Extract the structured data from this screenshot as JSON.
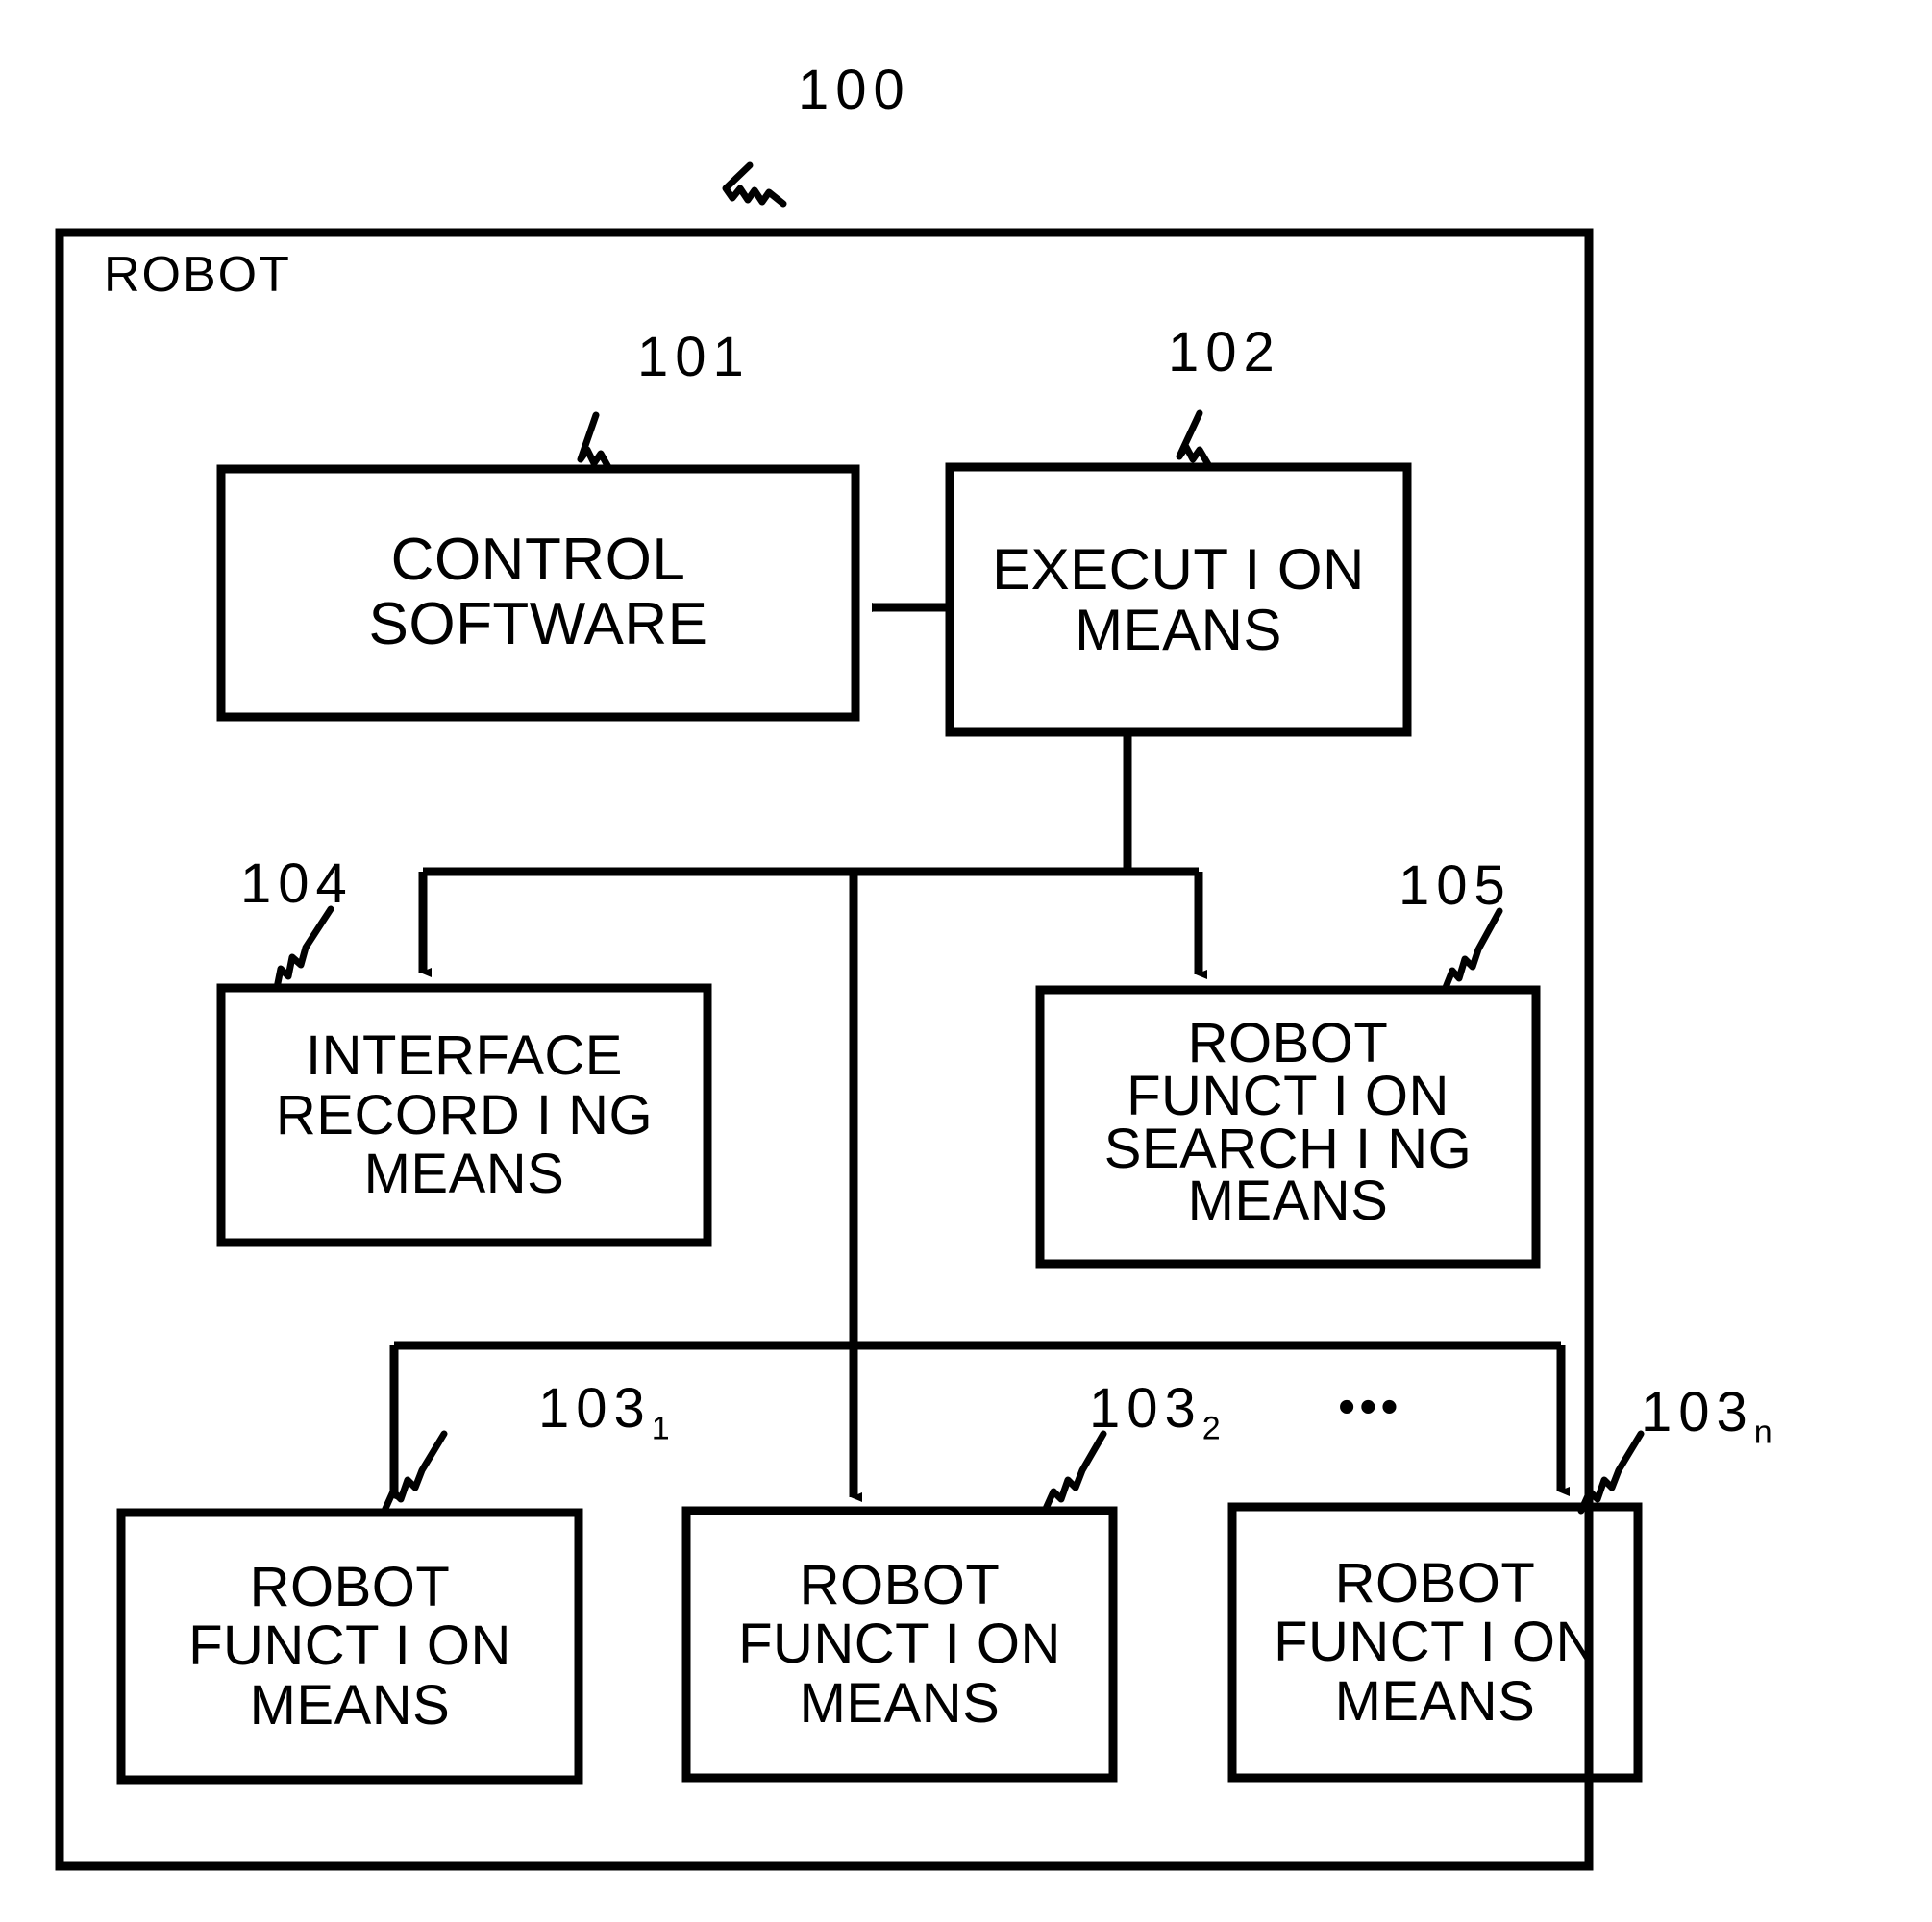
{
  "figure": {
    "top_reference": "100",
    "outer_box_title": "ROBOT"
  },
  "boxes": [
    {
      "id": "control-software",
      "reference": "101",
      "lines": [
        "CONTROL",
        "SOFTWARE"
      ]
    },
    {
      "id": "execution-means",
      "reference": "102",
      "lines": [
        "EXECUT I ON",
        "MEANS"
      ]
    },
    {
      "id": "interface-recording-means",
      "reference": "104",
      "lines": [
        "INTERFACE",
        "RECORD I NG",
        "MEANS"
      ]
    },
    {
      "id": "robot-function-searching-means",
      "reference": "105",
      "lines": [
        "ROBOT",
        "FUNCT I ON",
        "SEARCH I NG",
        "MEANS"
      ]
    },
    {
      "id": "robot-function-means-1",
      "reference": "103",
      "reference_subscript": "1",
      "lines": [
        "ROBOT",
        "FUNCT I ON",
        "MEANS"
      ]
    },
    {
      "id": "robot-function-means-2",
      "reference": "103",
      "reference_subscript": "2",
      "lines": [
        "ROBOT",
        "FUNCT I ON",
        "MEANS"
      ]
    },
    {
      "id": "robot-function-means-n",
      "reference": "103",
      "reference_subscript": "n",
      "lines": [
        "ROBOT",
        "FUNCT I ON",
        "MEANS"
      ]
    }
  ],
  "ellipsis": "•••",
  "colors": {
    "ink": "#000000",
    "paper": "#ffffff"
  },
  "text": {
    "ref_100": "100",
    "ref_101": "101",
    "ref_102": "102",
    "ref_104": "104",
    "ref_105": "105",
    "ref_103": "103",
    "sub_1": "1",
    "sub_2": "2",
    "sub_n": "n",
    "robot": "ROBOT",
    "control_l1": "CONTROL",
    "control_l2": "SOFTWARE",
    "exec_l1": "EXECUT I ON",
    "exec_l2": "MEANS",
    "iface_l1": "INTERFACE",
    "iface_l2": "RECORD I NG",
    "iface_l3": "MEANS",
    "search_l1": "ROBOT",
    "search_l2": "FUNCT I ON",
    "search_l3": "SEARCH I NG",
    "search_l4": "MEANS",
    "rf_l1": "ROBOT",
    "rf_l2": "FUNCT I ON",
    "rf_l3": "MEANS"
  }
}
